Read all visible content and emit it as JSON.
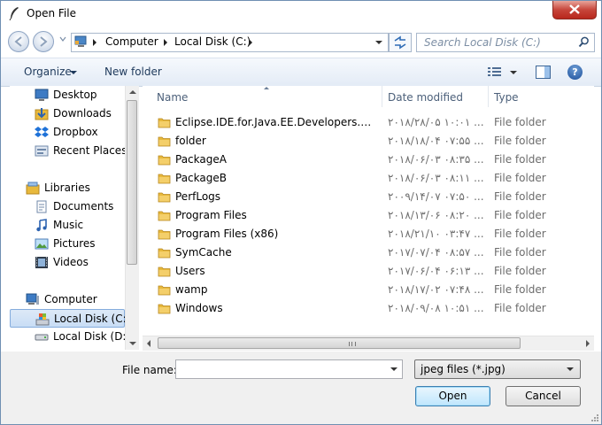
{
  "window": {
    "title": "Open File",
    "close_icon": "close-icon"
  },
  "address": {
    "crumbs": [
      "Computer",
      "Local Disk (C:)"
    ],
    "search_placeholder": "Search Local Disk (C:)"
  },
  "toolbar": {
    "organize": "Organize",
    "new_folder": "New folder",
    "help": "?"
  },
  "nav": {
    "favorites": [
      {
        "label": "Desktop",
        "icon": "desktop-icon"
      },
      {
        "label": "Downloads",
        "icon": "downloads-icon"
      },
      {
        "label": "Dropbox",
        "icon": "dropbox-icon"
      },
      {
        "label": "Recent Places",
        "icon": "recent-places-icon"
      }
    ],
    "libraries": {
      "label": "Libraries",
      "items": [
        {
          "label": "Documents",
          "icon": "documents-icon"
        },
        {
          "label": "Music",
          "icon": "music-icon"
        },
        {
          "label": "Pictures",
          "icon": "pictures-icon"
        },
        {
          "label": "Videos",
          "icon": "videos-icon"
        }
      ]
    },
    "computer": {
      "label": "Computer",
      "items": [
        {
          "label": "Local Disk (C:)",
          "icon": "drive-c-icon",
          "selected": true
        },
        {
          "label": "Local Disk (D:)",
          "icon": "drive-d-icon"
        }
      ]
    }
  },
  "columns": {
    "name": "Name",
    "date": "Date modified",
    "type": "Type"
  },
  "files": [
    {
      "name": "Eclipse.IDE.for.Java.EE.Developers.Neon.x...",
      "date": "۲۰۱۸/۲۸/۰۵ ۱۰:۰۱ ...",
      "type": "File folder"
    },
    {
      "name": "folder",
      "date": "۲۰۱۸/۱۸/۰۴ ۰۷:۵۵ ...",
      "type": "File folder"
    },
    {
      "name": "PackageA",
      "date": "۲۰۱۸/۰۶/۰۳ ۰۸:۳۵ ...",
      "type": "File folder"
    },
    {
      "name": "PackageB",
      "date": "۲۰۱۸/۰۶/۰۳ ۰۸:۱۱ ...",
      "type": "File folder"
    },
    {
      "name": "PerfLogs",
      "date": "۲۰۰۹/۱۴/۰۷ ۰۷:۵۰ ...",
      "type": "File folder"
    },
    {
      "name": "Program Files",
      "date": "۲۰۱۸/۱۳/۰۶ ۰۸:۲۰ ...",
      "type": "File folder"
    },
    {
      "name": "Program Files (x86)",
      "date": "۲۰۱۸/۲۱/۱۰ ۰۳:۴۷ ...",
      "type": "File folder"
    },
    {
      "name": "SymCache",
      "date": "۲۰۱۷/۰۷/۰۴ ۰۸:۵۷ ...",
      "type": "File folder"
    },
    {
      "name": "Users",
      "date": "۲۰۱۷/۰۶/۰۴ ۰۶:۱۳ ...",
      "type": "File folder"
    },
    {
      "name": "wamp",
      "date": "۲۰۱۸/۱۷/۰۲ ۰۷:۴۸ ...",
      "type": "File folder"
    },
    {
      "name": "Windows",
      "date": "۲۰۱۸/۰۹/۰۸ ۱۰:۵۱ ...",
      "type": "File folder"
    }
  ],
  "bottom": {
    "file_name_label": "File name:",
    "file_name_value": "",
    "file_type": "jpeg files (*.jpg)",
    "open": "Open",
    "cancel": "Cancel"
  },
  "colors": {
    "accent": "#3c7fb1",
    "selection": "#c8ddf5",
    "folder": "#e8b93c"
  }
}
